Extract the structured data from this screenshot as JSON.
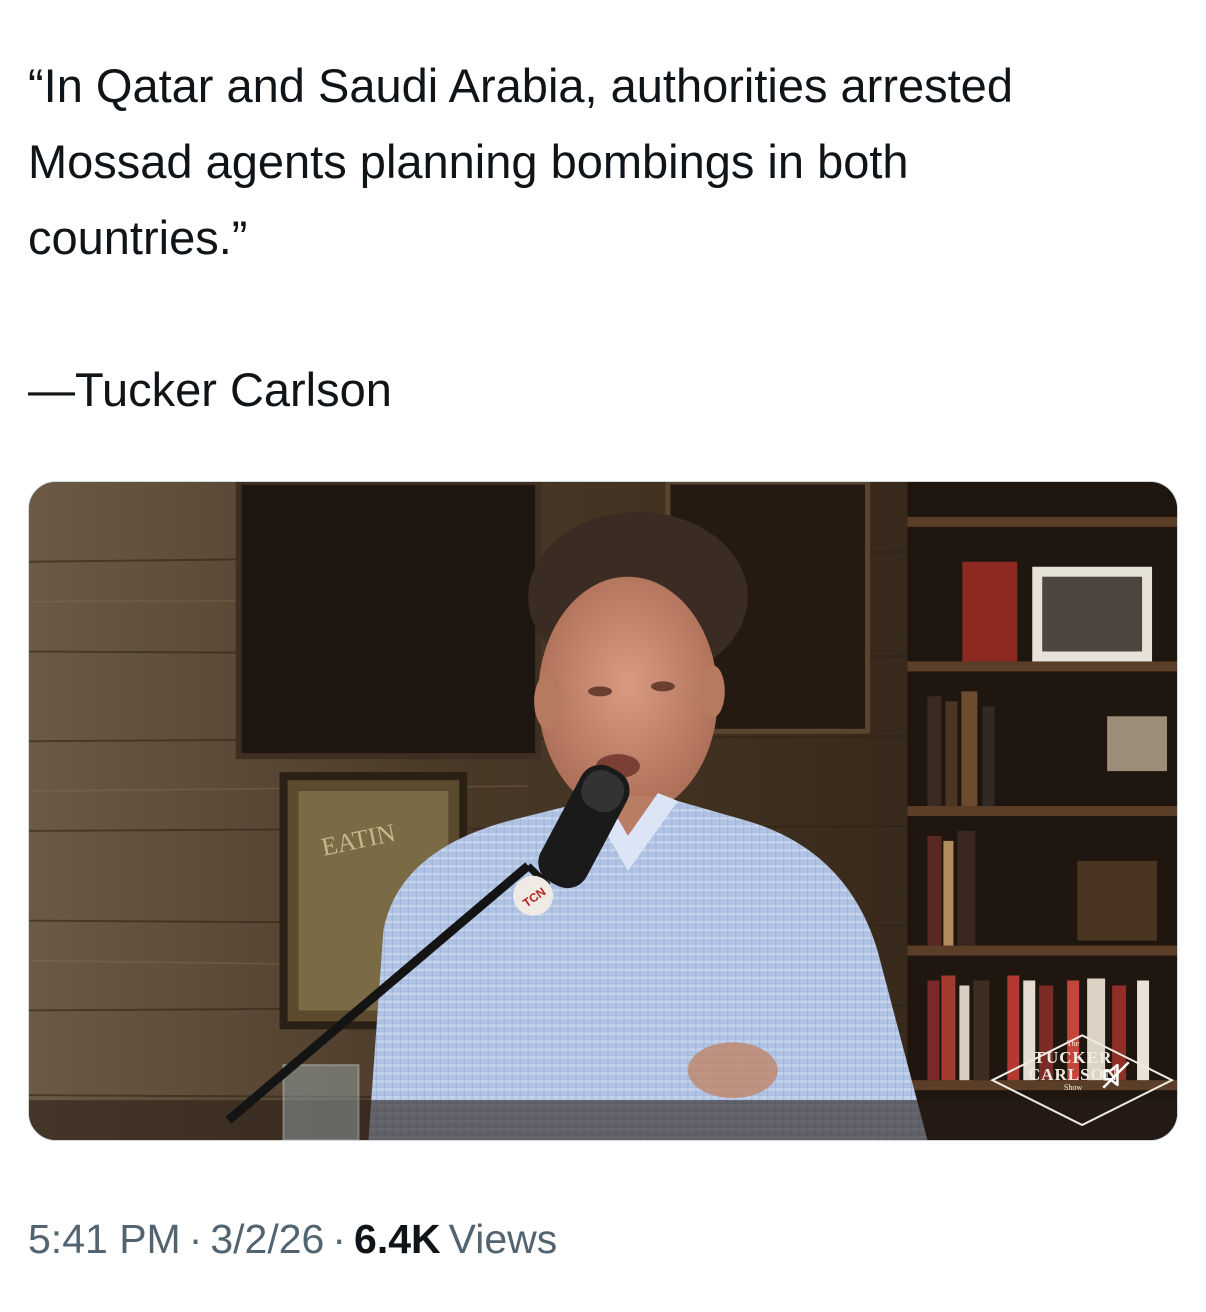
{
  "tweet": {
    "quote_text": "“In Qatar and Saudi Arabia, authorities arrested\nMossad agents planning bombings in both\ncountries.”",
    "attribution": "—Tucker Carlson"
  },
  "media": {
    "watermark_line1": "The",
    "watermark_line2": "TUCKER",
    "watermark_line3": "CARLSON",
    "watermark_line4": "Show",
    "mic_logo": "TCN",
    "icon": "speaker-muted-icon"
  },
  "meta": {
    "time": "5:41 PM",
    "separator": "·",
    "date": "3/2/26",
    "views_count": "6.4K",
    "views_label": "Views"
  },
  "colors": {
    "text_primary": "#0f1419",
    "text_secondary": "#536471",
    "border": "#cfd9de"
  }
}
